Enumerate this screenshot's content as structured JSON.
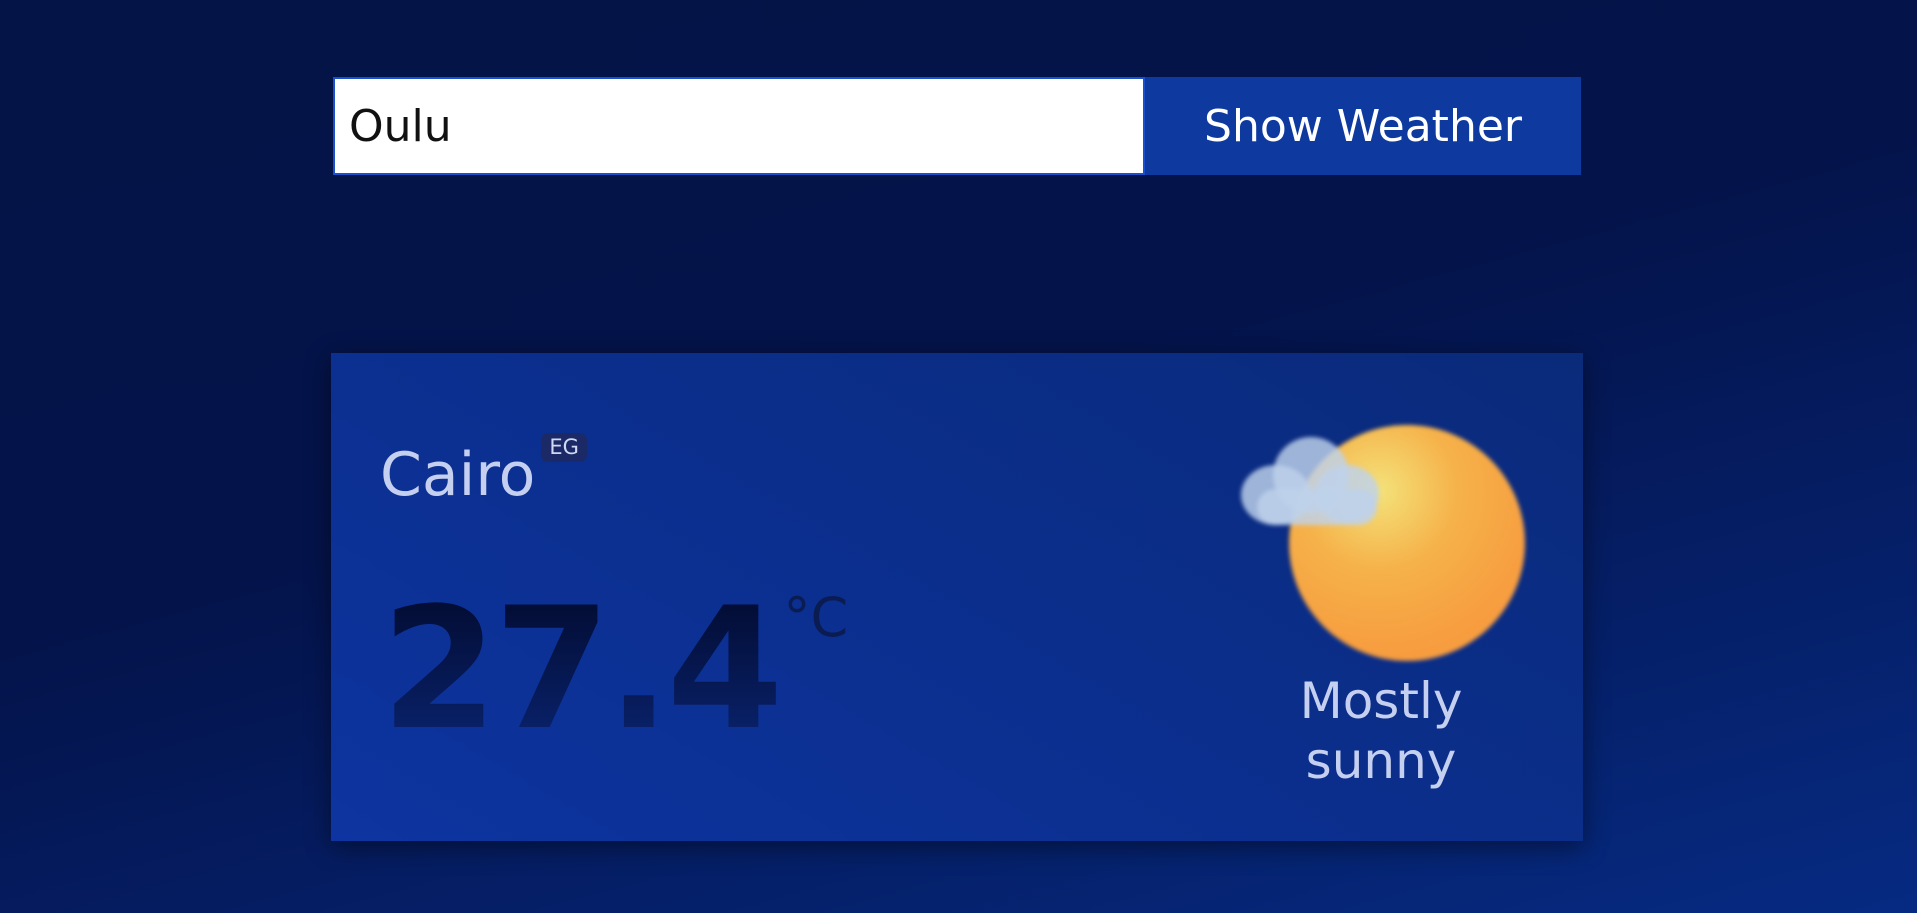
{
  "search": {
    "value": "Oulu",
    "button_label": "Show Weather"
  },
  "weather": {
    "city": "Cairo",
    "country_code": "EG",
    "temperature": "27.4",
    "unit": "°C",
    "condition": "Mostly sunny",
    "icon": "sun-behind-cloud-icon"
  },
  "colors": {
    "background": "#041446",
    "card": "#0b2f8f",
    "button": "#0e3aa0",
    "sun": "#f79e40"
  }
}
